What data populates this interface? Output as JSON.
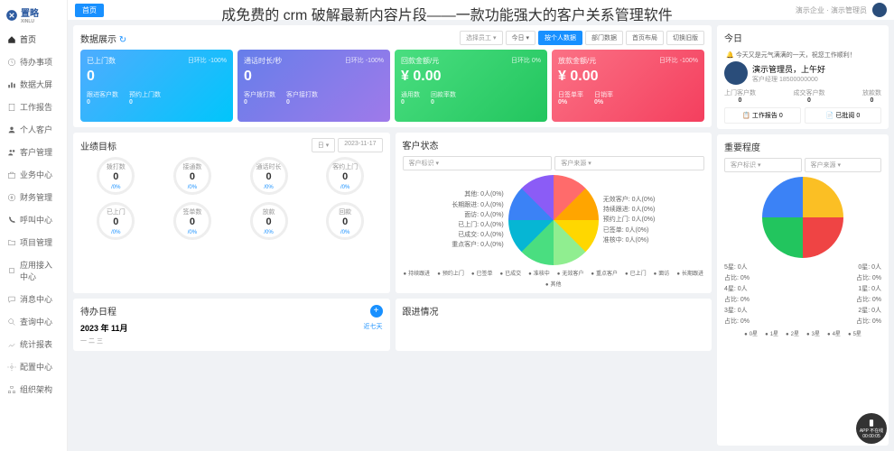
{
  "overlay": "成免费的 crm 破解最新内容片段——一款功能强大的客户关系管理软件",
  "logo": "置略",
  "logoEn": "XINLU",
  "topInfo": "演示企业 · 演示管理员",
  "menu": [
    "首页",
    "待办事项",
    "数据大屏",
    "工作报告",
    "个人客户",
    "客户管理",
    "业务中心",
    "财务管理",
    "呼叫中心",
    "项目管理",
    "应用接入中心",
    "消息中心",
    "查询中心",
    "统计报表",
    "配置中心",
    "组织架构"
  ],
  "tab": "首页",
  "dataTitle": "数据展示",
  "filters": {
    "emp": "选择员工",
    "t1": "今日",
    "t2": "按个人数据",
    "t3": "部门数据",
    "t4": "首页布局",
    "t5": "切换旧版"
  },
  "cards": [
    {
      "t": "已上门数",
      "s": "日环比 -100%",
      "v": "0",
      "s1": "跟进客户数",
      "v1": "0",
      "s2": "预约上门数",
      "v2": "0"
    },
    {
      "t": "通话时长/秒",
      "s": "日环比 -100%",
      "v": "0",
      "s1": "客户拨打数",
      "v1": "0",
      "s2": "客户接打数",
      "v2": "0"
    },
    {
      "t": "回款金额/元",
      "s": "日环比 0%",
      "v": "¥ 0.00",
      "s1": "通用数",
      "v1": "0",
      "s2": "回款率数",
      "v2": "0"
    },
    {
      "t": "放款金额/元",
      "s": "日环比 -100%",
      "v": "¥ 0.00",
      "s1": "日签单率",
      "v1": "0%",
      "s2": "日销率",
      "v2": "0%"
    }
  ],
  "perfTitle": "业绩目标",
  "perfDate": "2023-11-17",
  "perfDay": "日",
  "rings": [
    {
      "t": "拨打数",
      "v": "0",
      "p": "/0%"
    },
    {
      "t": "接通数",
      "v": "0",
      "p": "/0%"
    },
    {
      "t": "通话时长",
      "v": "0",
      "p": "/0%"
    },
    {
      "t": "客约上门",
      "v": "0",
      "p": "/0%"
    },
    {
      "t": "已上门",
      "v": "0",
      "p": "/0%"
    },
    {
      "t": "签单数",
      "v": "0",
      "p": "/0%"
    },
    {
      "t": "放款",
      "v": "0",
      "p": "/0%"
    },
    {
      "t": "回款",
      "v": "0",
      "p": "/0%"
    }
  ],
  "statusTitle": "客户状态",
  "sel1": "客户标识",
  "sel2": "客户来源",
  "statusItems": [
    "其他: 0人(0%)",
    "长期跟进: 0人(0%)",
    "面访: 0人(0%)",
    "已上门: 0人(0%)",
    "已成交: 0人(0%)",
    "重点客户: 0人(0%)",
    "无效客户: 0人(0%)",
    "持续跟进: 0人(0%)",
    "预约上门: 0人(0%)",
    "已签单: 0人(0%)",
    "准核中: 0人(0%)"
  ],
  "statusLeg": [
    "持续跟进",
    "预约上门",
    "已签单",
    "已成交",
    "准核中",
    "无效客户",
    "重点客户",
    "已上门",
    "面访",
    "长期跟进",
    "其他"
  ],
  "impTitle": "重要程度",
  "impRows": [
    {
      "l": "5星: 0人",
      "r": "0星: 0人",
      "l2": "占比: 0%",
      "r2": "占比: 0%"
    },
    {
      "l": "4星: 0人",
      "r": "1星: 0人",
      "l2": "占比: 0%",
      "r2": "占比: 0%"
    },
    {
      "l": "3星: 0人",
      "r": "2星: 0人",
      "l2": "占比: 0%",
      "r2": "占比: 0%"
    }
  ],
  "impLeg": [
    "0星",
    "1星",
    "2星",
    "3星",
    "4星",
    "5星"
  ],
  "todayTitle": "今日",
  "notification": "今天又是元气满满的一天，祝您工作顺利！",
  "userName": "演示管理员，上午好",
  "userRole": "客户经理",
  "userPhone": "18500000000",
  "userStats": [
    {
      "l": "上门客户数",
      "v": "0"
    },
    {
      "l": "成交客户数",
      "v": "0"
    },
    {
      "l": "放款数",
      "v": "0"
    }
  ],
  "btn1": "工作报告",
  "btn1c": "0",
  "btn2": "已批阅",
  "btn2c": "0",
  "schedTitle": "待办日程",
  "schedMonth": "2023 年 11月",
  "schedLink": "近七天",
  "followTitle": "跟进情况",
  "float1": "APP 不在线",
  "float2": "00:00:05",
  "icons": {
    "down": "▾",
    "plus": "+",
    "bell": "🔔"
  }
}
